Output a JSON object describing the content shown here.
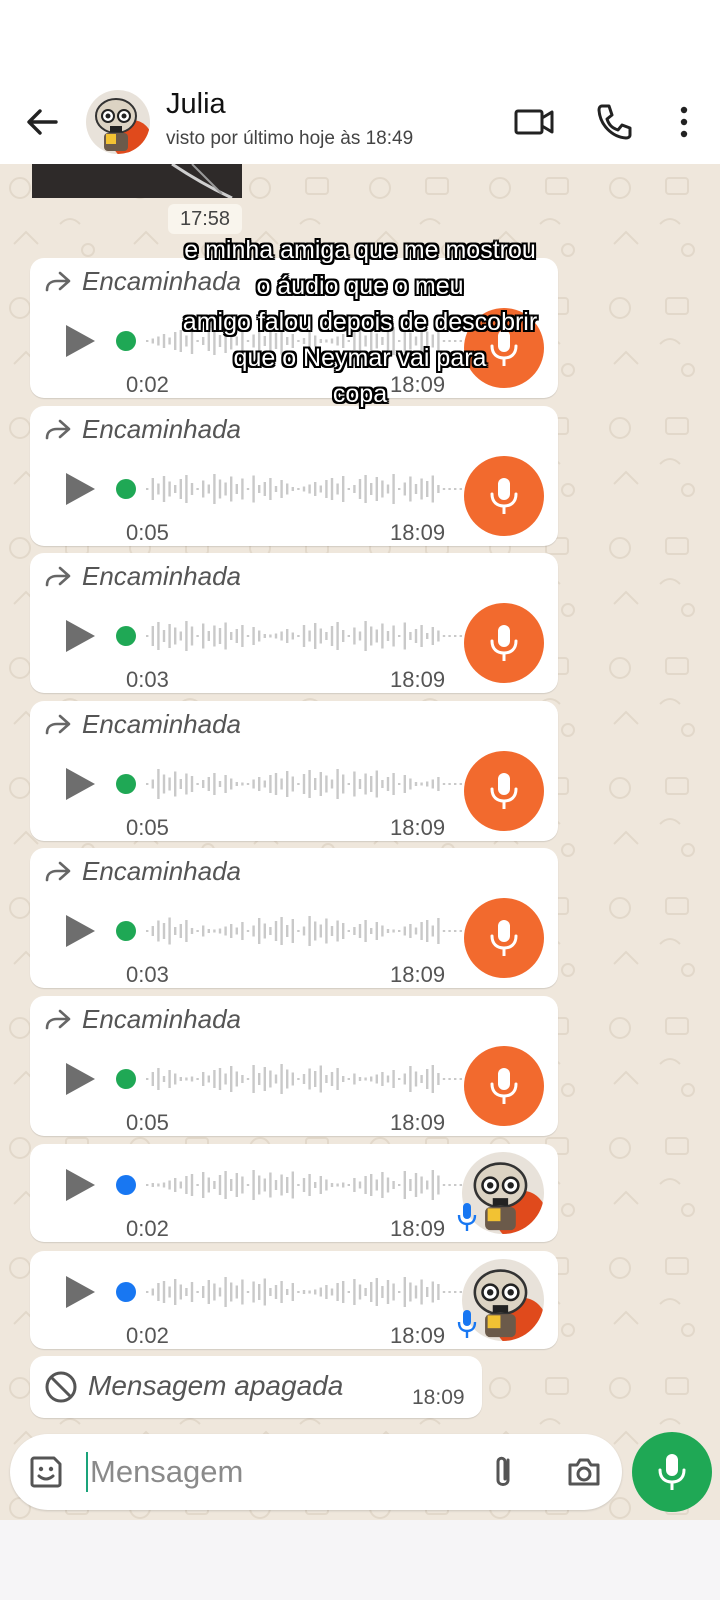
{
  "header": {
    "contact_name": "Julia",
    "last_seen": "visto por último hoje às 18:49"
  },
  "chat": {
    "image_time": "17:58",
    "forward_label": "Encaminhada",
    "voice_messages": [
      {
        "forwarded": true,
        "duration": "0:02",
        "time": "18:09",
        "kind": "mic"
      },
      {
        "forwarded": true,
        "duration": "0:05",
        "time": "18:09",
        "kind": "mic"
      },
      {
        "forwarded": true,
        "duration": "0:03",
        "time": "18:09",
        "kind": "mic"
      },
      {
        "forwarded": true,
        "duration": "0:05",
        "time": "18:09",
        "kind": "mic"
      },
      {
        "forwarded": true,
        "duration": "0:03",
        "time": "18:09",
        "kind": "mic"
      },
      {
        "forwarded": true,
        "duration": "0:05",
        "time": "18:09",
        "kind": "mic"
      },
      {
        "forwarded": false,
        "duration": "0:02",
        "time": "18:09",
        "kind": "avatar"
      },
      {
        "forwarded": false,
        "duration": "0:02",
        "time": "18:09",
        "kind": "avatar"
      }
    ],
    "deleted_message": {
      "label": "Mensagem apagada",
      "time": "18:09"
    }
  },
  "caption": {
    "lines": [
      "e minha amiga que me mostrou",
      "o áudio que o meu",
      "amigo falou depois de descobrir",
      "que o Neymar vai para",
      "copa"
    ]
  },
  "composer": {
    "placeholder": "Mensagem"
  },
  "colors": {
    "chat_bg": "#efe7dc",
    "mic_orange": "#f26a2e",
    "dot_green": "#1fa855",
    "dot_blue": "#1877f2",
    "send_green": "#1fa855"
  },
  "icons": [
    "back-arrow-icon",
    "video-call-icon",
    "phone-icon",
    "more-vert-icon",
    "forward-icon",
    "play-icon",
    "mic-icon",
    "ban-icon",
    "sticker-icon",
    "attach-icon",
    "camera-icon"
  ]
}
